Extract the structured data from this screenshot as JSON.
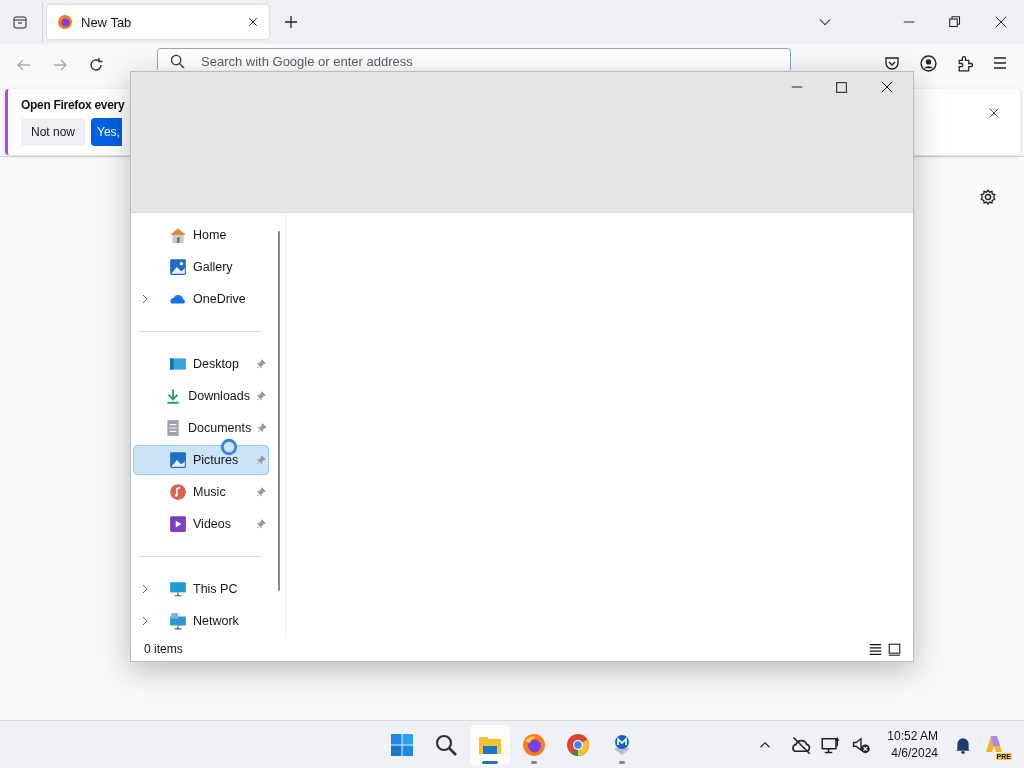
{
  "browser": {
    "tabs": [
      {
        "title": "New Tab",
        "selected": true
      }
    ],
    "address_bar": {
      "placeholder": "Search with Google or enter address"
    },
    "notification": {
      "message": "Open Firefox every",
      "buttons": [
        {
          "label": "Not now",
          "kind": "secondary"
        },
        {
          "label": "Yes,",
          "kind": "primary"
        }
      ]
    }
  },
  "explorer": {
    "nav_groups": [
      [
        {
          "label": "Home",
          "selected": false,
          "pinned": false,
          "expandable": false
        },
        {
          "label": "Gallery",
          "selected": false,
          "pinned": false,
          "expandable": false
        },
        {
          "label": "OneDrive",
          "selected": false,
          "pinned": false,
          "expandable": true
        }
      ],
      [
        {
          "label": "Desktop",
          "selected": false,
          "pinned": true,
          "expandable": false
        },
        {
          "label": "Downloads",
          "selected": false,
          "pinned": true,
          "expandable": false
        },
        {
          "label": "Documents",
          "selected": false,
          "pinned": true,
          "expandable": false
        },
        {
          "label": "Pictures",
          "selected": true,
          "pinned": true,
          "expandable": false
        },
        {
          "label": "Music",
          "selected": false,
          "pinned": true,
          "expandable": false
        },
        {
          "label": "Videos",
          "selected": false,
          "pinned": true,
          "expandable": false
        }
      ],
      [
        {
          "label": "This PC",
          "selected": false,
          "pinned": false,
          "expandable": true
        },
        {
          "label": "Network",
          "selected": false,
          "pinned": false,
          "expandable": true
        }
      ]
    ],
    "status_bar": {
      "item_count": "0 items"
    }
  },
  "taskbar": {
    "apps": [
      {
        "running": false,
        "active": false
      },
      {
        "running": false,
        "active": false
      },
      {
        "running": true,
        "active": true
      },
      {
        "running": true,
        "active": false
      },
      {
        "running": false,
        "active": false
      },
      {
        "running": true,
        "active": false
      }
    ],
    "clock": {
      "time": "10:52 AM",
      "date": "4/6/2024"
    },
    "copilot_badge": "PRE"
  }
}
